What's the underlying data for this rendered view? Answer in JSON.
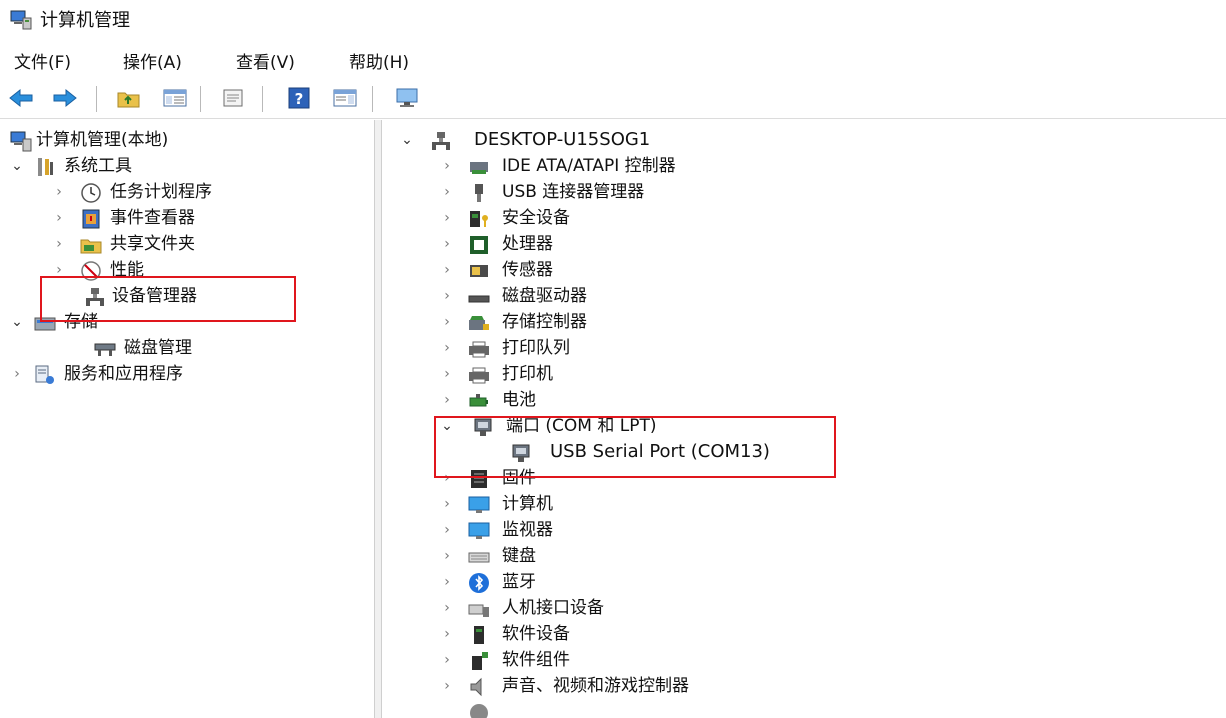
{
  "window": {
    "title": "计算机管理"
  },
  "menu": [
    "文件(F)",
    "操作(A)",
    "查看(V)",
    "帮助(H)"
  ],
  "toolbar": [
    "back-arrow-icon",
    "forward-arrow-icon",
    "folder-up-icon",
    "show-hide-tree-icon",
    "properties-icon",
    "help-icon",
    "action-pane-icon",
    "monitor-icon"
  ],
  "left_tree": {
    "root": "计算机管理(本地)",
    "system_tools": "系统工具",
    "task_scheduler": "任务计划程序",
    "event_viewer": "事件查看器",
    "shared_folders": "共享文件夹",
    "performance": "性能",
    "device_manager": "设备管理器",
    "storage": "存储",
    "disk_management": "磁盘管理",
    "services_apps": "服务和应用程序"
  },
  "device_tree": {
    "computer": "DESKTOP-U15SOG1",
    "categories": [
      "IDE ATA/ATAPI 控制器",
      "USB 连接器管理器",
      "安全设备",
      "处理器",
      "传感器",
      "磁盘驱动器",
      "存储控制器",
      "打印队列",
      "打印机",
      "电池",
      "端口 (COM 和 LPT)",
      "固件",
      "计算机",
      "监视器",
      "键盘",
      "蓝牙",
      "人机接口设备",
      "软件设备",
      "软件组件",
      "声音、视频和游戏控制器"
    ],
    "port_child": "USB Serial Port (COM13)"
  },
  "colors": {
    "highlight": "#e0161d",
    "accent": "#1e6fd9"
  }
}
